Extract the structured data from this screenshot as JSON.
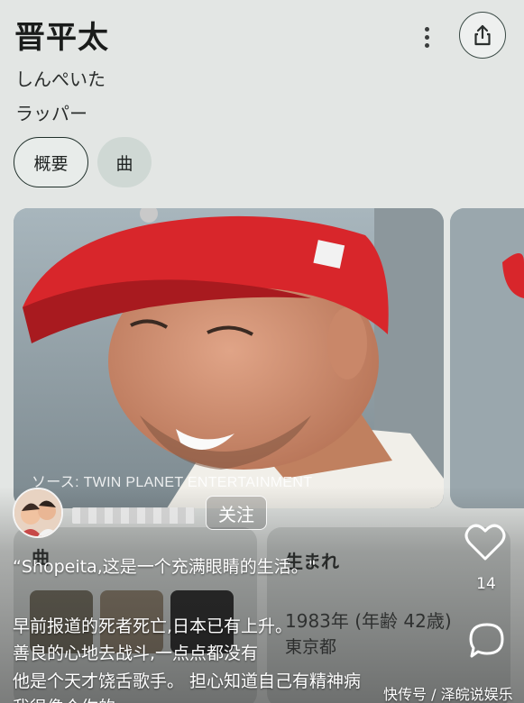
{
  "header": {
    "title": "晋平太",
    "reading": "しんぺいた",
    "occupation": "ラッパー",
    "share_icon": "share-icon",
    "more_icon": "more-vert-icon"
  },
  "tabs": [
    {
      "label": "概要",
      "selected": true
    },
    {
      "label": "曲",
      "selected": false
    }
  ],
  "photo": {
    "source": "ソース: TWIN PLANET ENTERTAINMENT"
  },
  "panels": {
    "songs_label": "曲",
    "born_label": "生まれ",
    "born_date": "1983年 (年齢 42歳)",
    "born_place": "東京都"
  },
  "overlay": {
    "follow_label": "关注",
    "caption_lines": [
      "“Shopeita,这是一个充满眼睛的生活。\"",
      "早前报道的死者死亡,日本已有上升。",
      "善良的心地去战斗,一点点都没有",
      "他是个天才饶舌歌手。 担心知道自己有精神病",
      "我很像个你的"
    ],
    "like_count": "14",
    "like_icon": "heart-icon",
    "comment_icon": "comment-icon",
    "watermark": "快传号 / 泽皖说娱乐"
  },
  "colors": {
    "accent": "#20302b",
    "tab_inactive_bg": "#cfd8d4",
    "cap_red": "#d8262b"
  }
}
